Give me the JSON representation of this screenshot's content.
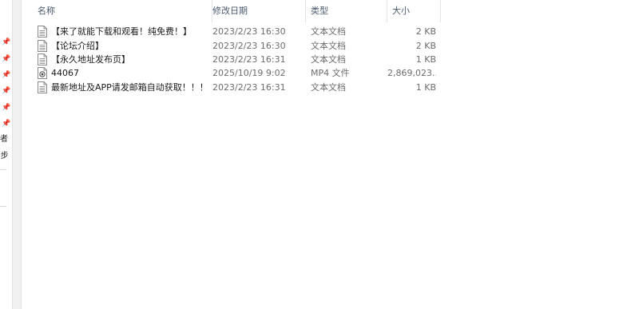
{
  "columns": {
    "name": "名称",
    "date": "修改日期",
    "type": "类型",
    "size": "大小"
  },
  "nav": {
    "item1": "者",
    "item2": "-步"
  },
  "files": [
    {
      "name": "【来了就能下载和观看！纯免费！】",
      "date": "2023/2/23 16:30",
      "type": "文本文档",
      "size": "2 KB",
      "icon": "text-document-icon"
    },
    {
      "name": "【论坛介绍】",
      "date": "2023/2/23 16:30",
      "type": "文本文档",
      "size": "2 KB",
      "icon": "text-document-icon"
    },
    {
      "name": "【永久地址发布页】",
      "date": "2023/2/23 16:31",
      "type": "文本文档",
      "size": "1 KB",
      "icon": "text-document-icon"
    },
    {
      "name": "44067",
      "date": "2025/10/19 9:02",
      "type": "MP4 文件",
      "size": "2,869,023...",
      "icon": "video-file-icon"
    },
    {
      "name": "最新地址及APP请发邮箱自动获取！！！",
      "date": "2023/2/23 16:31",
      "type": "文本文档",
      "size": "1 KB",
      "icon": "text-document-icon"
    }
  ]
}
